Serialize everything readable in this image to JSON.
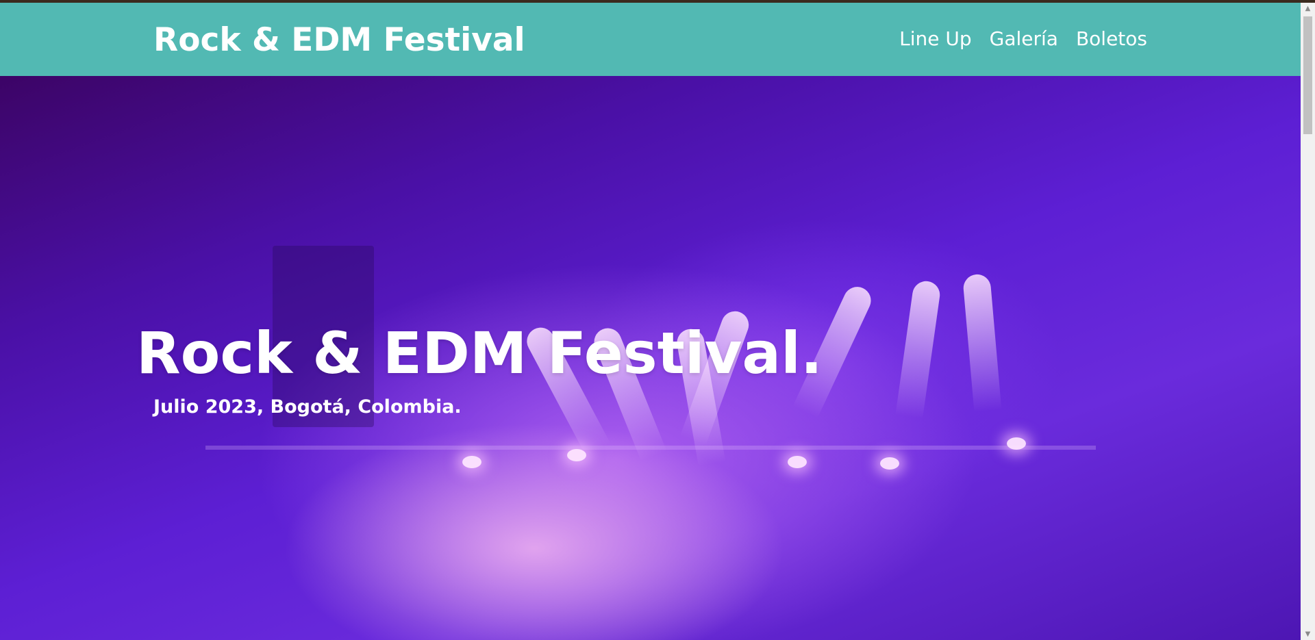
{
  "header": {
    "site_title": "Rock & EDM Festival",
    "nav": [
      {
        "label": "Line Up"
      },
      {
        "label": "Galería"
      },
      {
        "label": "Boletos"
      }
    ]
  },
  "hero": {
    "title": "Rock & EDM Festival.",
    "subtitle": "Julio 2023, Bogotá, Colombia."
  },
  "colors": {
    "header_bg": "#52b9b3",
    "hero_base": "#5d1fd4",
    "text": "#ffffff"
  },
  "icons": {
    "scroll_up": "scroll-up-arrow-icon",
    "scroll_down": "scroll-down-arrow-icon"
  }
}
